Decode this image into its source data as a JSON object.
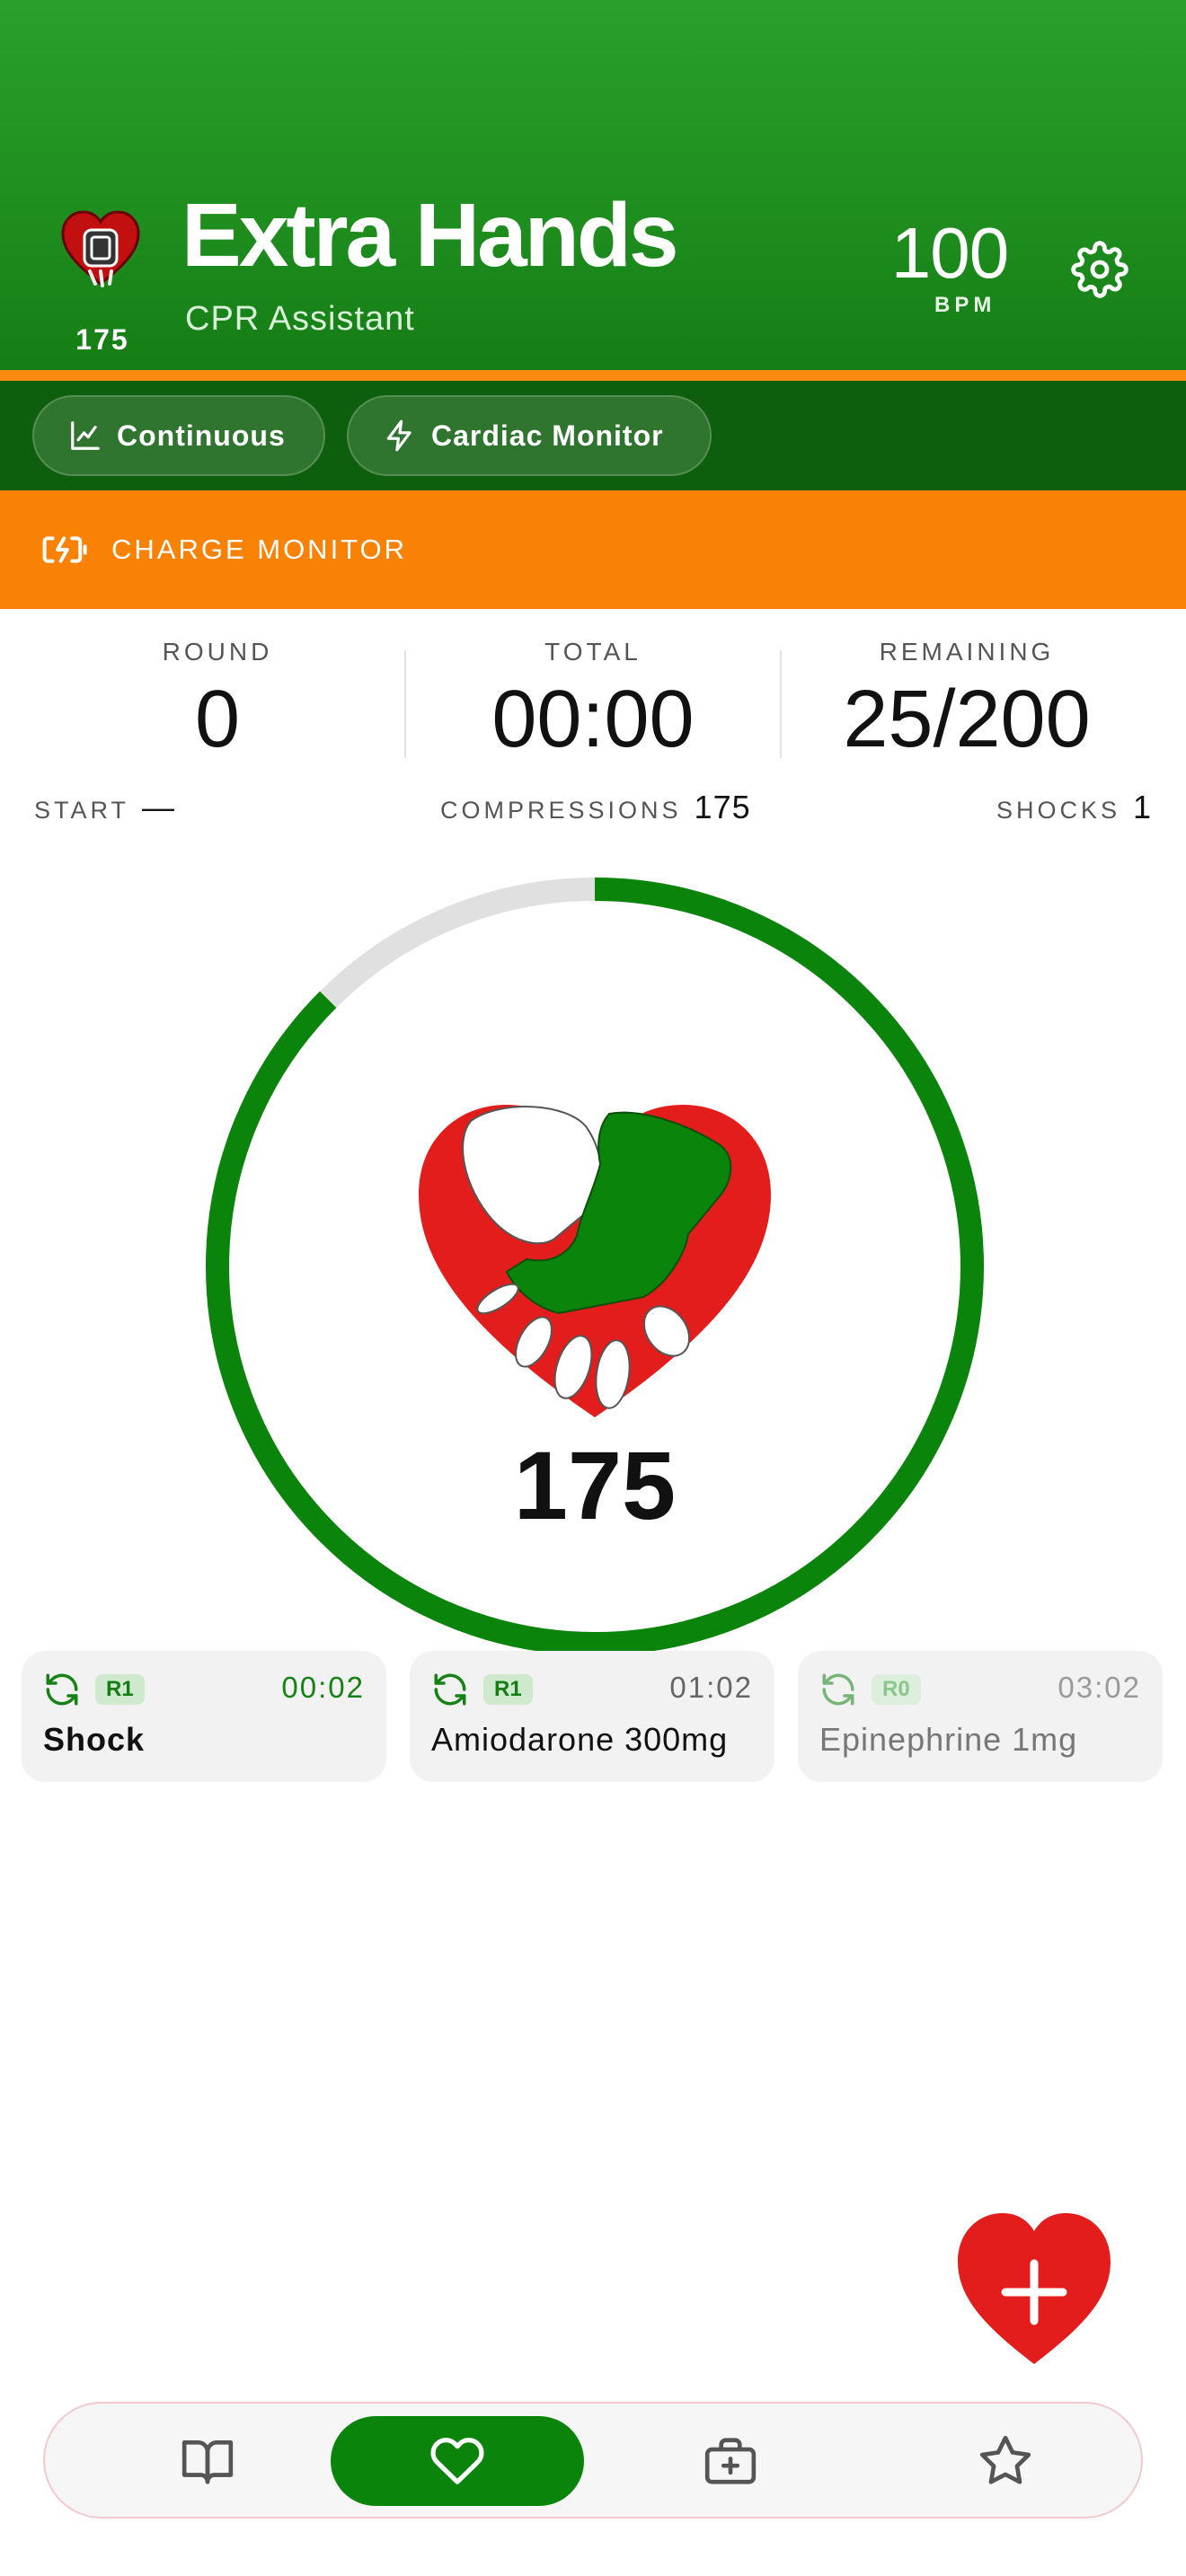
{
  "header": {
    "title": "Extra Hands",
    "subtitle": "CPR Assistant",
    "logo_count": "175",
    "bpm_value": "100",
    "bpm_unit": "BPM",
    "settings_icon": "gear-icon"
  },
  "modes": [
    {
      "label": "Continuous",
      "icon": "chart-line-icon"
    },
    {
      "label": "Cardiac Monitor",
      "icon": "lightning-icon"
    }
  ],
  "alert": {
    "label": "CHARGE MONITOR",
    "icon": "battery-charging-icon",
    "color": "#f98104"
  },
  "stats": {
    "round_label": "ROUND",
    "round_value": "0",
    "total_label": "TOTAL",
    "total_value": "00:00",
    "remaining_label": "REMAINING",
    "remaining_value": "25/200"
  },
  "summary": {
    "start_label": "START",
    "start_value": "—",
    "compressions_label": "COMPRESSIONS",
    "compressions_value": "175",
    "shocks_label": "SHOCKS",
    "shocks_value": "1"
  },
  "progress": {
    "count": "175",
    "fraction": 0.875,
    "color": "#0b840b",
    "track_color": "#e0e0e0"
  },
  "events": [
    {
      "round": "R1",
      "time": "00:02",
      "name": "Shock",
      "icon": "repeat-icon"
    },
    {
      "round": "R1",
      "time": "01:02",
      "name": "Amiodarone 300mg",
      "icon": "repeat-icon"
    },
    {
      "round": "R0",
      "time": "03:02",
      "name": "Epinephrine 1mg",
      "icon": "repeat-icon"
    }
  ],
  "fab": {
    "icon": "heart-plus-icon",
    "color": "#e31c1c"
  },
  "nav": [
    {
      "icon": "book-icon",
      "active": false
    },
    {
      "icon": "heart-icon",
      "active": true
    },
    {
      "icon": "medical-kit-icon",
      "active": false
    },
    {
      "icon": "star-icon",
      "active": false
    }
  ],
  "colors": {
    "primary": "#1f8f1f",
    "primary_dark": "#0d5f0d",
    "accent": "#f98a12",
    "heart_red": "#e31c1c"
  }
}
